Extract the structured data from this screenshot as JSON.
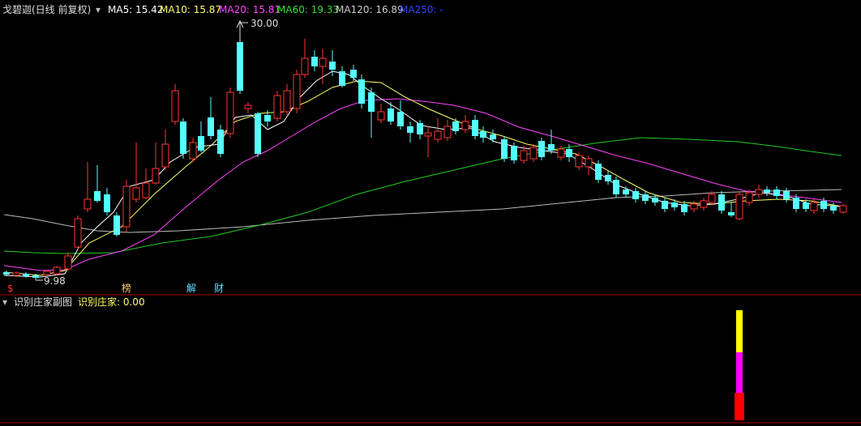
{
  "header": {
    "collapse_glyph": "▾",
    "title": "戈碧迦(日线 前复权)",
    "ma_items": [
      {
        "key": "MA5",
        "label": "MA5: 15.42",
        "color": "#ffffff"
      },
      {
        "key": "MA10",
        "label": "MA10: 15.87",
        "color": "#ffff66"
      },
      {
        "key": "MA20",
        "label": "MA20: 15.81",
        "color": "#ff44ff"
      },
      {
        "key": "MA60",
        "label": "MA60: 19.33",
        "color": "#33dd33"
      },
      {
        "key": "MA120",
        "label": "MA120: 16.89",
        "color": "#cccccc"
      },
      {
        "key": "MA250",
        "label": "MA250: -",
        "color": "#3344ff"
      }
    ]
  },
  "main_chart": {
    "price_high_label": "30.00",
    "price_low_label": "9.98",
    "event_markers": [
      {
        "text": "$",
        "color": "#ff3333"
      },
      {
        "text": "榜",
        "color": "#ffcc66"
      },
      {
        "text": "解",
        "color": "#66ddff"
      },
      {
        "text": "财",
        "color": "#66ddff"
      }
    ]
  },
  "sub_chart": {
    "title": "识别庄家副图",
    "indicator_label": "识别庄家: 0.00",
    "indicator_color": "#ffff66"
  },
  "colors": {
    "background": "#000000",
    "up_candle": "#ff3333",
    "down_candle": "#54ffff",
    "divider": "#aa0000"
  },
  "icons": {
    "collapse": "chevron-down-icon",
    "high_marker": "arrow-icon"
  }
}
